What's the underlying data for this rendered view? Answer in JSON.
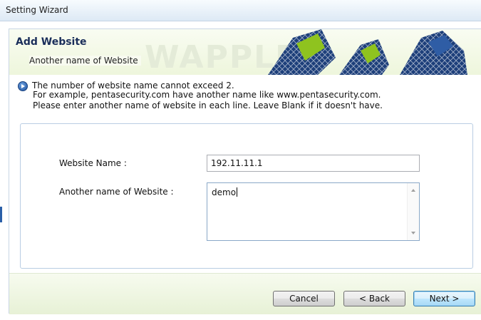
{
  "window": {
    "title": "Setting Wizard"
  },
  "banner": {
    "title": "Add Website",
    "subtitle": "Another name of Website",
    "watermark": "WAPPLES"
  },
  "info": {
    "icon": "arrow-circle-icon",
    "line1": "The number of website name cannot exceed 2.",
    "line2": "For example, pentasecurity.com have another name like www.pentasecurity.com.",
    "line3": "Please enter another name of website in each line. Leave Blank if it doesn't have."
  },
  "form": {
    "website_name_label": "Website Name :",
    "website_name_value": "192.11.11.1",
    "alias_label": "Another name of Website :",
    "alias_value": "demo"
  },
  "buttons": {
    "cancel": "Cancel",
    "back": "< Back",
    "next": "Next >"
  },
  "colors": {
    "accent": "#1a2e5a",
    "banner_bg": "#eef6dc",
    "panel_border": "#b9cde3",
    "logo_green": "#8fc31f",
    "logo_navy": "#1d3f7a"
  }
}
